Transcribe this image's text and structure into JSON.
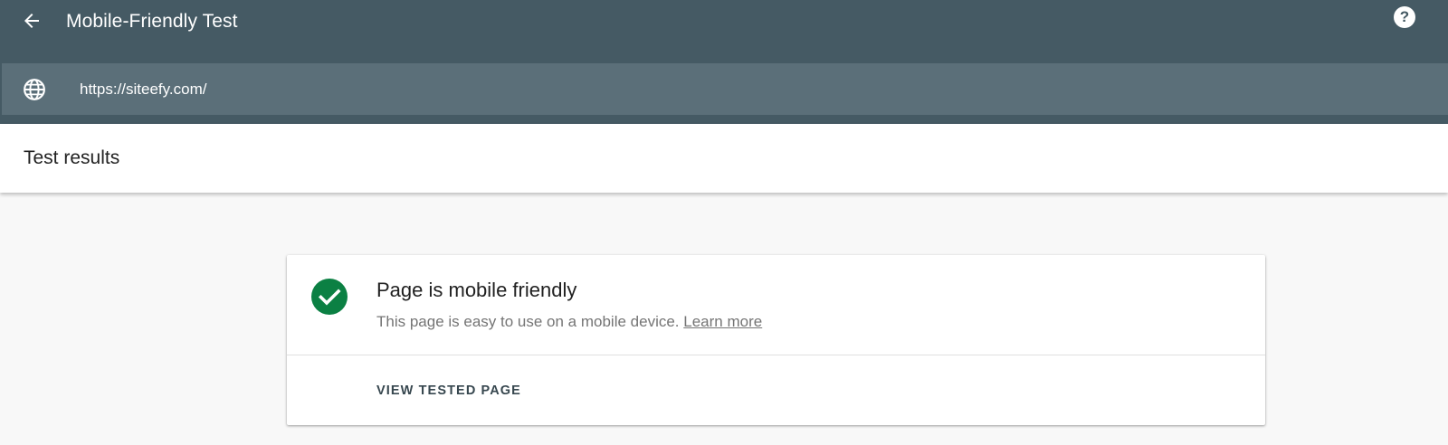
{
  "header": {
    "title": "Mobile-Friendly Test",
    "back_icon": "arrow-back-icon",
    "help_icon": "help-icon",
    "help_glyph": "?"
  },
  "url_bar": {
    "icon": "globe-icon",
    "value": "https://siteefy.com/"
  },
  "results": {
    "title": "Test results"
  },
  "verdict": {
    "icon": "check-circle-icon",
    "title": "Page is mobile friendly",
    "description": "This page is easy to use on a mobile device.",
    "learn_more_label": "Learn more",
    "view_tested_page_label": "VIEW TESTED PAGE"
  },
  "colors": {
    "topbar": "#455a64",
    "url_bar": "#5b6f79",
    "success": "#0b8043",
    "background": "#f8f8f8"
  }
}
